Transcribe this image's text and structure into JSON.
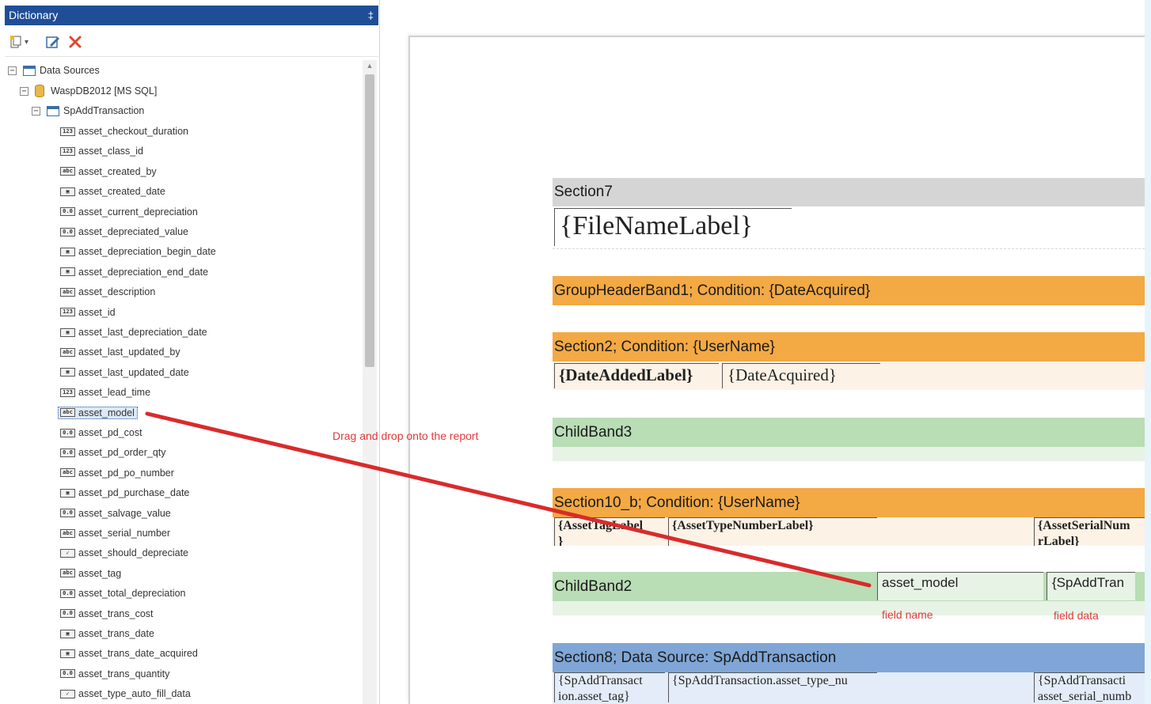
{
  "dictionary": {
    "title": "Dictionary",
    "pin_glyph": "‡",
    "toolbar": {
      "new_icon": "new-item-icon",
      "edit_icon": "edit-icon",
      "delete_icon": "delete-icon",
      "dropdown_glyph": "▾"
    },
    "tree": {
      "root_label": "Data Sources",
      "db_label": "WaspDB2012 [MS SQL]",
      "table_label": "SpAddTransaction",
      "fields": [
        {
          "name": "asset_checkout_duration",
          "type": "123"
        },
        {
          "name": "asset_class_id",
          "type": "123"
        },
        {
          "name": "asset_created_by",
          "type": "abc"
        },
        {
          "name": "asset_created_date",
          "type": "date"
        },
        {
          "name": "asset_current_depreciation",
          "type": "0.0"
        },
        {
          "name": "asset_depreciated_value",
          "type": "0.0"
        },
        {
          "name": "asset_depreciation_begin_date",
          "type": "date"
        },
        {
          "name": "asset_depreciation_end_date",
          "type": "date"
        },
        {
          "name": "asset_description",
          "type": "abc"
        },
        {
          "name": "asset_id",
          "type": "123"
        },
        {
          "name": "asset_last_depreciation_date",
          "type": "date"
        },
        {
          "name": "asset_last_updated_by",
          "type": "abc"
        },
        {
          "name": "asset_last_updated_date",
          "type": "date"
        },
        {
          "name": "asset_lead_time",
          "type": "123"
        },
        {
          "name": "asset_model",
          "type": "abc",
          "selected": true
        },
        {
          "name": "asset_pd_cost",
          "type": "0.0"
        },
        {
          "name": "asset_pd_order_qty",
          "type": "0.0"
        },
        {
          "name": "asset_pd_po_number",
          "type": "abc"
        },
        {
          "name": "asset_pd_purchase_date",
          "type": "date"
        },
        {
          "name": "asset_salvage_value",
          "type": "0.0"
        },
        {
          "name": "asset_serial_number",
          "type": "abc"
        },
        {
          "name": "asset_should_depreciate",
          "type": "check"
        },
        {
          "name": "asset_tag",
          "type": "abc"
        },
        {
          "name": "asset_total_depreciation",
          "type": "0.0"
        },
        {
          "name": "asset_trans_cost",
          "type": "0.0"
        },
        {
          "name": "asset_trans_date",
          "type": "date"
        },
        {
          "name": "asset_trans_date_acquired",
          "type": "date"
        },
        {
          "name": "asset_trans_quantity",
          "type": "0.0"
        },
        {
          "name": "asset_type_auto_fill_data",
          "type": "check"
        }
      ],
      "expanded_glyph": "−"
    }
  },
  "annotations": {
    "drag_hint": "Drag and drop onto the report",
    "field_name": "field name",
    "field_data": "field data",
    "color": "#e03a3a"
  },
  "report": {
    "section7": {
      "title": "Section7",
      "field": "{FileNameLabel}"
    },
    "group_header": {
      "title": "GroupHeaderBand1; Condition: {DateAcquired}"
    },
    "section2": {
      "title": "Section2; Condition: {UserName}",
      "label": "{DateAddedLabel}",
      "value": "{DateAcquired}"
    },
    "childband3": {
      "title": "ChildBand3"
    },
    "section10": {
      "title": "Section10_b; Condition: {UserName}",
      "col1": "{AssetTagLabel",
      "col1_wrap": "}",
      "col2": "{AssetTypeNumberLabel}",
      "col3": "{AssetSerialNum",
      "col3_wrap": "rLabel}"
    },
    "childband2": {
      "title": "ChildBand2",
      "field_name": "asset_model",
      "field_data": "{SpAddTran"
    },
    "section8": {
      "title": "Section8; Data Source: SpAddTransaction",
      "col1": "{SpAddTransact",
      "col1_wrap": "ion.asset_tag}",
      "col2": "{SpAddTransaction.asset_type_nu",
      "col3": "{SpAddTransacti",
      "col3_wrap": "asset_serial_numb"
    },
    "colors": {
      "gray": "#d5d5d5",
      "orange": "#f3a944",
      "green": "#b9ddb5",
      "blue": "#7fa6d6"
    }
  }
}
